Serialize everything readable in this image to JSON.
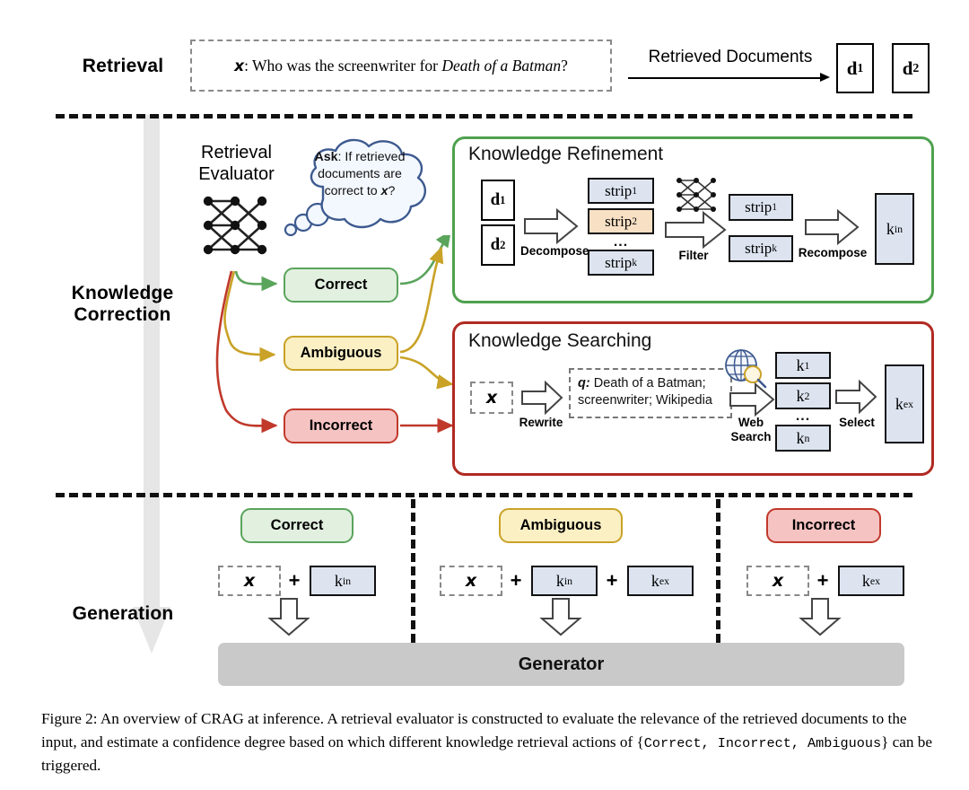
{
  "figure": {
    "stages": [
      {
        "id": "retrieval",
        "label": "Retrieval"
      },
      {
        "id": "knowledge-correction",
        "label": "Knowledge\nCorrection",
        "line1": "Knowledge",
        "line2": "Correction"
      },
      {
        "id": "generation",
        "label": "Generation"
      }
    ],
    "caption_prefix": "Figure 2:",
    "caption_part1": " An overview of CRAG at inference. A retrieval evaluator is constructed to evaluate the relevance of the retrieved documents to the input, and estimate a confidence degree based on which different knowledge retrieval actions of {",
    "caption_actions": "Correct, Incorrect, Ambiguous",
    "caption_part2": "} can be triggered."
  },
  "retrieval": {
    "query_prefix": "x",
    "query_colon": ": Who was the screenwriter for ",
    "query_italic": "Death of a Batman",
    "query_suffix": "?",
    "arrow_label": "Retrieved Documents",
    "documents": [
      {
        "label": "d",
        "sub": "1"
      },
      {
        "label": "d",
        "sub": "2"
      }
    ]
  },
  "correction": {
    "evaluator_title_line1": "Retrieval",
    "evaluator_title_line2": "Evaluator",
    "bubble": {
      "ask_label": "Ask",
      "line1_rest": ": If retrieved",
      "line2": "documents are",
      "line3_pre": "correct to ",
      "line3_var": "x",
      "line3_post": "?"
    },
    "decisions": [
      {
        "id": "correct",
        "label": "Correct",
        "color": "#5aa45c"
      },
      {
        "id": "ambiguous",
        "label": "Ambiguous",
        "color": "#c9a227"
      },
      {
        "id": "incorrect",
        "label": "Incorrect",
        "color": "#c0392b"
      }
    ],
    "refinement": {
      "title": "Knowledge Refinement",
      "inputs": [
        {
          "label": "d",
          "sub": "1"
        },
        {
          "label": "d",
          "sub": "2"
        }
      ],
      "step1_label": "Decompose",
      "strips_all": [
        {
          "label": "strip",
          "sub": "1",
          "tone": "blue"
        },
        {
          "label": "strip",
          "sub": "2",
          "tone": "tan"
        },
        {
          "label": "strip",
          "sub": "k",
          "tone": "blue"
        }
      ],
      "ellipsis": "...",
      "step2_label": "Filter",
      "strips_kept": [
        {
          "label": "strip",
          "sub": "1",
          "tone": "blue"
        },
        {
          "label": "strip",
          "sub": "k",
          "tone": "blue"
        }
      ],
      "step3_label": "Recompose",
      "output": {
        "label": "k",
        "sub": "in"
      }
    },
    "searching": {
      "title": "Knowledge Searching",
      "input_var": "x",
      "step1_label": "Rewrite",
      "rewritten_prefix": "q:",
      "rewritten_line1": " Death of a Batman;",
      "rewritten_line2": "screenwriter; Wikipedia",
      "step2_label_line1": "Web",
      "step2_label_line2": "Search",
      "results": [
        {
          "label": "k",
          "sub": "1"
        },
        {
          "label": "k",
          "sub": "2"
        },
        {
          "label": "k",
          "sub": "n"
        }
      ],
      "ellipsis": "...",
      "step3_label": "Select",
      "output": {
        "label": "k",
        "sub": "ex"
      }
    }
  },
  "generation": {
    "columns": [
      {
        "id": "correct",
        "pill_label": "Correct",
        "pill_class": "correct",
        "input_var": "x",
        "knowledge": [
          {
            "label": "k",
            "sub": "in"
          }
        ],
        "plus": "+"
      },
      {
        "id": "ambiguous",
        "pill_label": "Ambiguous",
        "pill_class": "ambig",
        "input_var": "x",
        "knowledge": [
          {
            "label": "k",
            "sub": "in"
          },
          {
            "label": "k",
            "sub": "ex"
          }
        ],
        "plus": "+"
      },
      {
        "id": "incorrect",
        "pill_label": "Incorrect",
        "pill_class": "incorrect",
        "input_var": "x",
        "knowledge": [
          {
            "label": "k",
            "sub": "ex"
          }
        ],
        "plus": "+"
      }
    ],
    "generator_label": "Generator"
  },
  "colors": {
    "green": "#4fa14f",
    "red": "#b12a22",
    "yellow": "#c9a227",
    "blue_box": "#dde4f0",
    "tan_box": "#f7e0c4",
    "grey_arrow": "#e6e6e6",
    "generator_bar": "#c9c9c9",
    "bubble_stroke": "#3d5a8f"
  }
}
